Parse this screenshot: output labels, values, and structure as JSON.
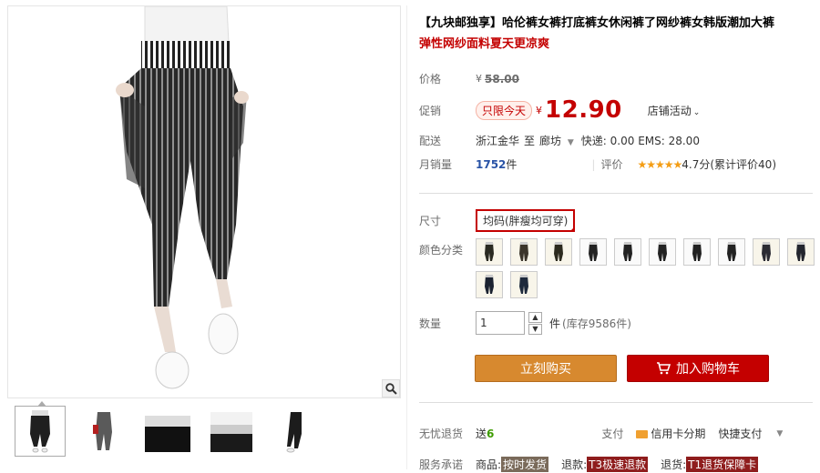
{
  "product": {
    "title": "【九块邮独享】哈伦裤女裤打底裤女休闲裤了网纱裤女韩版潮加大裤",
    "subtitle": "弹性网纱面料夏天更凉爽"
  },
  "price_row": {
    "label": "价格",
    "currency": "¥",
    "original": "58.00"
  },
  "promo_row": {
    "label": "促销",
    "badge": "只限今天",
    "currency": "¥",
    "price": "12.90",
    "shop_activity": "店铺活动"
  },
  "shipping_row": {
    "label": "配送",
    "origin": "浙江金华",
    "to": "至",
    "dest": "廊坊",
    "fees": "快递: 0.00 EMS: 28.00"
  },
  "sales_row": {
    "label": "月销量",
    "count": "1752",
    "unit": "件",
    "rating_label": "评价",
    "stars": "★★★★★",
    "rating_text": "4.7分(累计评价40)"
  },
  "size_row": {
    "label": "尺寸",
    "value": "均码(胖瘦均可穿)"
  },
  "color_row": {
    "label": "颜色分类",
    "swatch_colors": [
      "#2a2a22",
      "#3b352b",
      "#2c2a1e",
      "#f4f4f4",
      "#f2f2f2",
      "#f3f3f3",
      "#f1f1f1",
      "#f0f0f0",
      "#2b2b33",
      "#24262e",
      "#1b2230",
      "#1e2a3c"
    ]
  },
  "quantity_row": {
    "label": "数量",
    "value": "1",
    "unit": "件",
    "stock": "(库存9586件)"
  },
  "buttons": {
    "buy_now": "立刻购买",
    "add_cart": "加入购物车"
  },
  "bottom": {
    "worry_label": "无忧退货",
    "worry_value": "送",
    "worry_num": "6",
    "pay_label": "支付",
    "credit": "信用卡分期",
    "quick": "快捷支付",
    "service_label": "服务承诺",
    "s1_pre": "商品:",
    "s1_tag": "按时发货",
    "s2_pre": "退款:",
    "s2_tag": "T3极速退款",
    "s3_pre": "退货:",
    "s3_tag": "T1退货保障卡"
  },
  "colors": {
    "accent": "#c40000",
    "buy": "#d7892f",
    "cart": "#c40000",
    "star": "#f49d14"
  }
}
